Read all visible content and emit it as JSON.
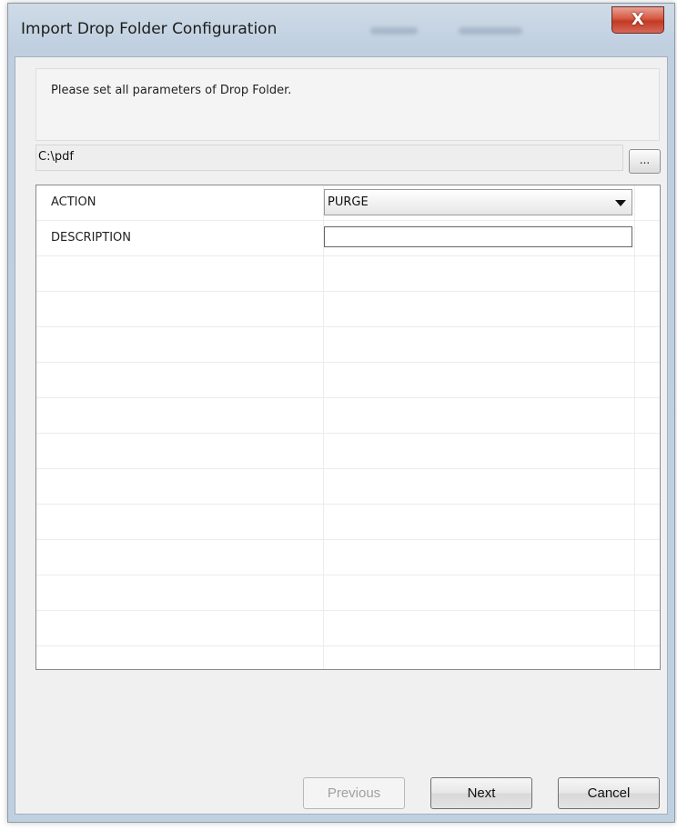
{
  "window": {
    "title": "Import Drop Folder Configuration",
    "close_glyph": "X"
  },
  "info": {
    "message": "Please set all parameters of Drop Folder."
  },
  "path": {
    "value": "C:\\pdf",
    "browse_label": "..."
  },
  "grid": {
    "rows": [
      {
        "label": "ACTION",
        "type": "select",
        "value": "PURGE"
      },
      {
        "label": "DESCRIPTION",
        "type": "text",
        "value": ""
      }
    ]
  },
  "buttons": {
    "previous": "Previous",
    "next": "Next",
    "cancel": "Cancel"
  },
  "colors": {
    "close_button": "#c23a22",
    "client_background": "#f0f0f0",
    "grid_line": "#ececec"
  }
}
